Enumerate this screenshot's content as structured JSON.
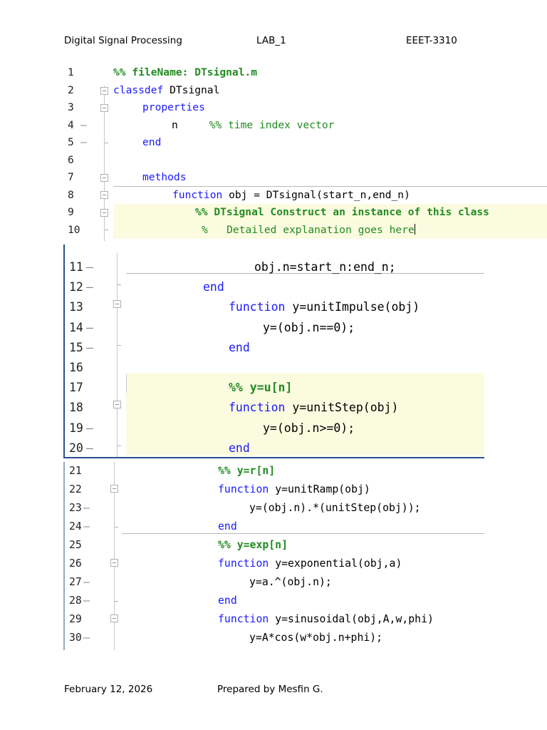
{
  "header": {
    "course": "Digital Signal Processing",
    "lab": "LAB_1",
    "code": "EEET-3310"
  },
  "footer": {
    "date": "February 12, 2026",
    "author": "Prepared by Mesfin G."
  },
  "block1": {
    "l1": "%% fileName: DTsignal.m",
    "l2a": "classdef",
    "l2b": " DTsignal",
    "l3": "properties",
    "l4a": "n     ",
    "l4b": "%% time index vector",
    "l5": "end",
    "l7": "methods",
    "l8a": "function",
    "l8b": " obj = DTsignal(start_n,end_n)",
    "l9": "%% DTsignal Construct an instance of this class",
    "l10": "%   Detailed explanation goes here"
  },
  "block2": {
    "l11": "obj.n=start_n:end_n;",
    "l12": "end",
    "l13a": "function",
    "l13b": " y=unitImpulse(obj)",
    "l14": "y=(obj.n==0);",
    "l15": "end",
    "l17": "%% y=u[n]",
    "l18a": "function",
    "l18b": " y=unitStep(obj)",
    "l19": "y=(obj.n>=0);",
    "l20": "end"
  },
  "block3": {
    "l21": "%% y=r[n]",
    "l22a": "function",
    "l22b": " y=unitRamp(obj)",
    "l23": "y=(obj.n).*(unitStep(obj));",
    "l24": "end",
    "l25": "%% y=exp[n]",
    "l26a": "function",
    "l26b": " y=exponential(obj,a)",
    "l27": "y=a.^(obj.n);",
    "l28": "end",
    "l29a": "function",
    "l29b": " y=sinusoidal(obj,A,w,phi)",
    "l30": "y=A*cos(w*obj.n+phi);"
  },
  "line_numbers": {
    "b1": [
      "1",
      "2",
      "3",
      "4",
      "5",
      "6",
      "7",
      "8",
      "9",
      "10"
    ],
    "b2": [
      "11",
      "12",
      "13",
      "14",
      "15",
      "16",
      "17",
      "18",
      "19",
      "20"
    ],
    "b3": [
      "21",
      "22",
      "23",
      "24",
      "25",
      "26",
      "27",
      "28",
      "29",
      "30"
    ]
  },
  "colors": {
    "keyword": "#1a1aff",
    "comment": "#228b22",
    "highlight": "#fbfbe0",
    "border": "#2a4f8f"
  }
}
